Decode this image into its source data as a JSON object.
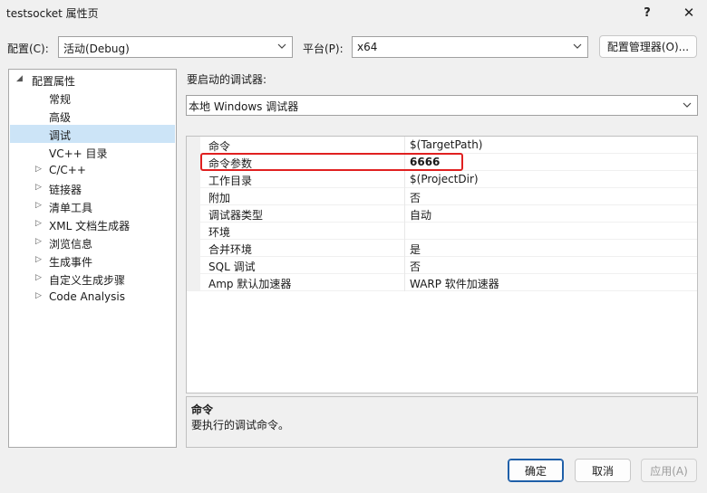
{
  "window": {
    "title": "testsocket 属性页",
    "help": "?",
    "close": "✕"
  },
  "config": {
    "label": "配置(C):",
    "value": "活动(Debug)"
  },
  "platform": {
    "label": "平台(P):",
    "value": "x64"
  },
  "config_manager": "配置管理器(O)...",
  "tree": [
    {
      "label": "配置属性",
      "expanded": true
    },
    {
      "label": "常规"
    },
    {
      "label": "高级"
    },
    {
      "label": "调试",
      "selected": true
    },
    {
      "label": "VC++ 目录"
    },
    {
      "label": "C/C++"
    },
    {
      "label": "链接器"
    },
    {
      "label": "清单工具"
    },
    {
      "label": "XML 文档生成器"
    },
    {
      "label": "浏览信息"
    },
    {
      "label": "生成事件"
    },
    {
      "label": "自定义生成步骤"
    },
    {
      "label": "Code Analysis"
    }
  ],
  "debugger": {
    "label": "要启动的调试器:",
    "value": "本地 Windows 调试器"
  },
  "properties": [
    {
      "name": "命令",
      "value": "$(TargetPath)"
    },
    {
      "name": "命令参数",
      "value": "6666"
    },
    {
      "name": "工作目录",
      "value": "$(ProjectDir)"
    },
    {
      "name": "附加",
      "value": "否"
    },
    {
      "name": "调试器类型",
      "value": "自动"
    },
    {
      "name": "环境",
      "value": ""
    },
    {
      "name": "合并环境",
      "value": "是"
    },
    {
      "name": "SQL 调试",
      "value": "否"
    },
    {
      "name": "Amp 默认加速器",
      "value": "WARP 软件加速器"
    }
  ],
  "description": {
    "title": "命令",
    "text": "要执行的调试命令。"
  },
  "buttons": {
    "ok": "确定",
    "cancel": "取消",
    "apply": "应用(A)"
  },
  "colors": {
    "selection": "#cce4f7",
    "highlight": "#e02020",
    "primary_border": "#1f5fa8"
  }
}
